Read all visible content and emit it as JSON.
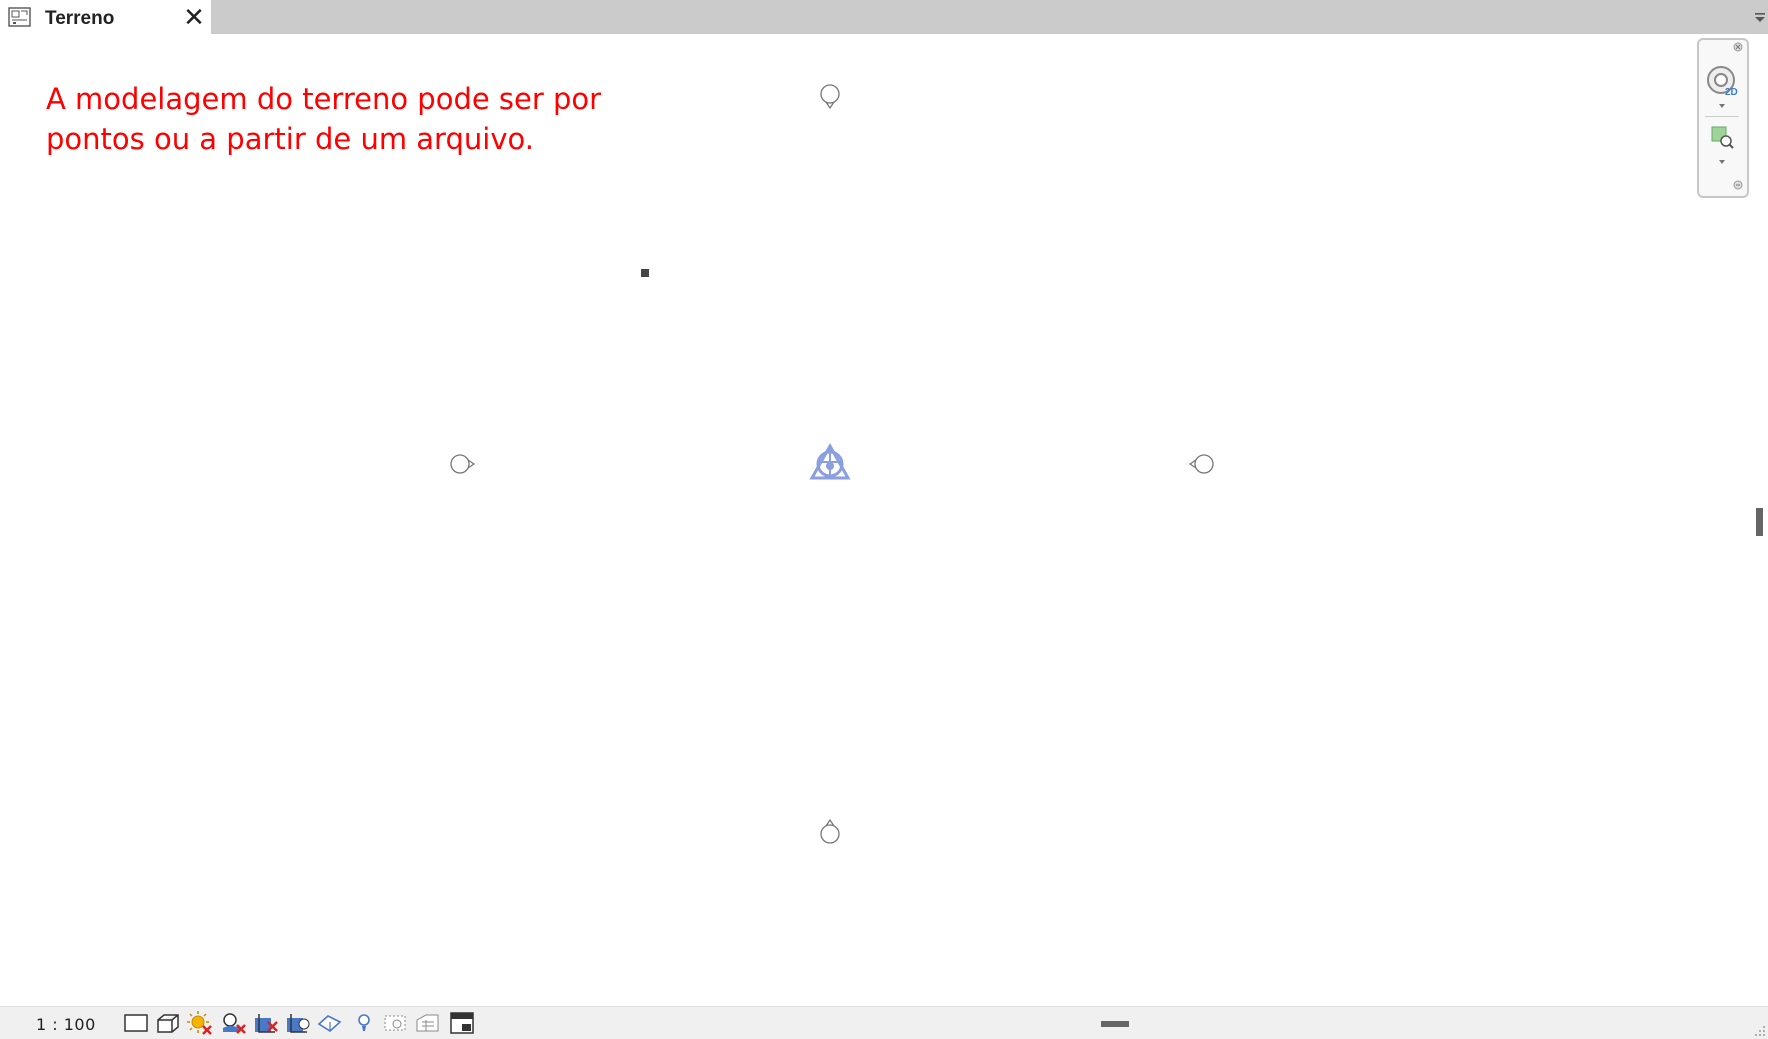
{
  "tab": {
    "title": "Terreno",
    "close_glyph": "✕",
    "icon": "floor-plan-view-icon"
  },
  "canvas": {
    "note_line1": "A modelagem do terreno pode ser por",
    "note_line2": "pontos ou a partir de um arquivo.",
    "note_color": "#ff0000",
    "markers": [
      "elevation-marker-north",
      "elevation-marker-west",
      "elevation-marker-east",
      "elevation-marker-south",
      "survey-point-icon",
      "project-base-point"
    ]
  },
  "navigation_bar": {
    "items": [
      "steering-wheel-2d-icon",
      "zoom-region-icon"
    ]
  },
  "status_bar": {
    "scale": "1 : 100",
    "icons": [
      "detail-level-icon",
      "visual-style-icon",
      "sun-path-icon",
      "shadows-icon",
      "crop-view-icon",
      "show-crop-region-icon",
      "unlock-3d-view-icon",
      "temporary-hide-icon",
      "reveal-hidden-icon",
      "worksharing-display-icon",
      "highlight-displacement-icon",
      "analytical-model-icon"
    ]
  },
  "colors": {
    "tabbar": "#cbcbcb",
    "accent_marker": "#8a9ee0"
  }
}
